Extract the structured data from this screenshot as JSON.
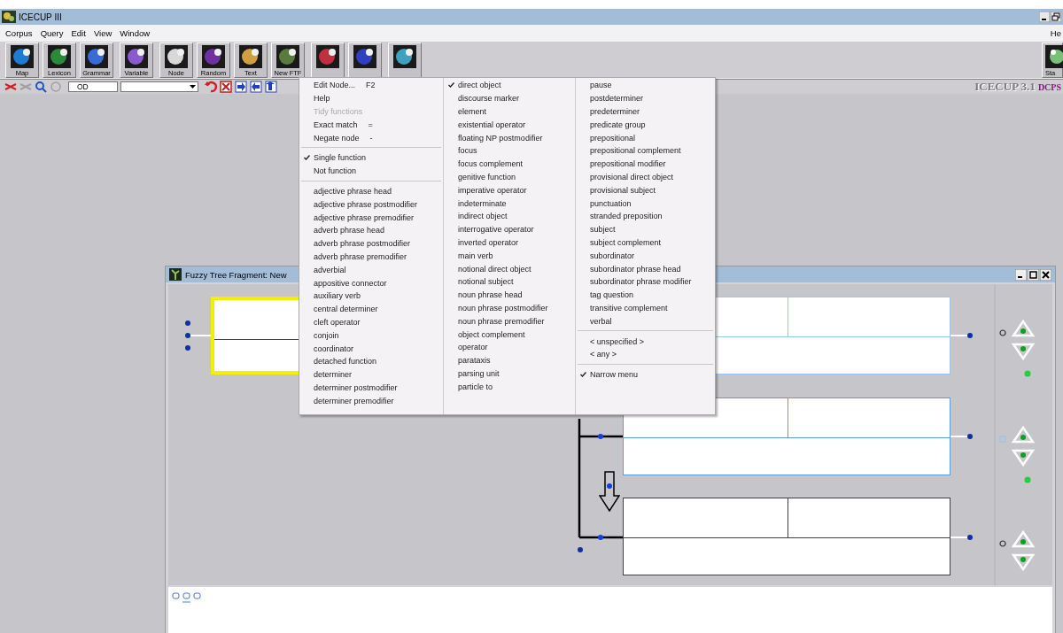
{
  "window": {
    "title": "ICECUP III"
  },
  "menu_bar": {
    "items": [
      "Corpus",
      "Query",
      "Edit",
      "View",
      "Window"
    ],
    "right_item": "He"
  },
  "toolbar": {
    "buttons": [
      {
        "kind": "labeled",
        "label": "Map"
      },
      {
        "kind": "labeled",
        "label": "Lexicon"
      },
      {
        "kind": "labeled",
        "label": "Grammar"
      },
      {
        "kind": "labeled",
        "label": "Variable"
      },
      {
        "kind": "labeled",
        "label": "Node"
      },
      {
        "kind": "labeled",
        "label": "Random"
      },
      {
        "kind": "labeled",
        "label": "Text"
      },
      {
        "kind": "labeled",
        "label": "New FTF"
      },
      {
        "kind": "covered"
      },
      {
        "kind": "covered"
      },
      {
        "kind": "covered"
      }
    ],
    "right_button": {
      "label": "Sta"
    }
  },
  "query_bar": {
    "node_field": "OD",
    "brand": "ICECUP 3.1",
    "brand_suffix": "DCPS"
  },
  "context_menu": {
    "columns": [
      [
        {
          "kind": "item",
          "label": "Edit Node...",
          "shortcut": "F2",
          "checked": false,
          "disabled": false
        },
        {
          "kind": "item",
          "label": "Help",
          "checked": false,
          "disabled": false
        },
        {
          "kind": "item",
          "label": "Tidy functions",
          "checked": false,
          "disabled": true
        },
        {
          "kind": "item",
          "label": "Exact match",
          "shortcut": "=",
          "checked": false,
          "disabled": false
        },
        {
          "kind": "item",
          "label": "Negate node",
          "shortcut": "-",
          "checked": false,
          "disabled": false
        },
        {
          "kind": "separator"
        },
        {
          "kind": "item",
          "label": "Single function",
          "checked": true,
          "disabled": false
        },
        {
          "kind": "item",
          "label": "Not function",
          "checked": false,
          "disabled": false
        },
        {
          "kind": "separator"
        },
        {
          "kind": "item",
          "label": "adjective phrase head",
          "checked": false,
          "disabled": false
        },
        {
          "kind": "item",
          "label": "adjective phrase postmodifier",
          "checked": false,
          "disabled": false
        },
        {
          "kind": "item",
          "label": "adjective phrase premodifier",
          "checked": false,
          "disabled": false
        },
        {
          "kind": "item",
          "label": "adverb phrase head",
          "checked": false,
          "disabled": false
        },
        {
          "kind": "item",
          "label": "adverb phrase postmodifier",
          "checked": false,
          "disabled": false
        },
        {
          "kind": "item",
          "label": "adverb phrase premodifier",
          "checked": false,
          "disabled": false
        },
        {
          "kind": "item",
          "label": "adverbial",
          "checked": false,
          "disabled": false
        },
        {
          "kind": "item",
          "label": "appositive connector",
          "checked": false,
          "disabled": false
        },
        {
          "kind": "item",
          "label": "auxiliary verb",
          "checked": false,
          "disabled": false
        },
        {
          "kind": "item",
          "label": "central determiner",
          "checked": false,
          "disabled": false
        },
        {
          "kind": "item",
          "label": "cleft operator",
          "checked": false,
          "disabled": false
        },
        {
          "kind": "item",
          "label": "conjoin",
          "checked": false,
          "disabled": false
        },
        {
          "kind": "item",
          "label": "coordinator",
          "checked": false,
          "disabled": false
        },
        {
          "kind": "item",
          "label": "detached function",
          "checked": false,
          "disabled": false
        },
        {
          "kind": "item",
          "label": "determiner",
          "checked": false,
          "disabled": false
        },
        {
          "kind": "item",
          "label": "determiner postmodifier",
          "checked": false,
          "disabled": false
        },
        {
          "kind": "item",
          "label": "determiner premodifier",
          "checked": false,
          "disabled": false
        }
      ],
      [
        {
          "kind": "item",
          "label": "direct object",
          "checked": true,
          "disabled": false
        },
        {
          "kind": "item",
          "label": "discourse marker",
          "checked": false,
          "disabled": false
        },
        {
          "kind": "item",
          "label": "element",
          "checked": false,
          "disabled": false
        },
        {
          "kind": "item",
          "label": "existential operator",
          "checked": false,
          "disabled": false
        },
        {
          "kind": "item",
          "label": "floating NP postmodifier",
          "checked": false,
          "disabled": false
        },
        {
          "kind": "item",
          "label": "focus",
          "checked": false,
          "disabled": false
        },
        {
          "kind": "item",
          "label": "focus complement",
          "checked": false,
          "disabled": false
        },
        {
          "kind": "item",
          "label": "genitive function",
          "checked": false,
          "disabled": false
        },
        {
          "kind": "item",
          "label": "imperative operator",
          "checked": false,
          "disabled": false
        },
        {
          "kind": "item",
          "label": "indeterminate",
          "checked": false,
          "disabled": false
        },
        {
          "kind": "item",
          "label": "indirect object",
          "checked": false,
          "disabled": false
        },
        {
          "kind": "item",
          "label": "interrogative operator",
          "checked": false,
          "disabled": false
        },
        {
          "kind": "item",
          "label": "inverted operator",
          "checked": false,
          "disabled": false
        },
        {
          "kind": "item",
          "label": "main verb",
          "checked": false,
          "disabled": false
        },
        {
          "kind": "item",
          "label": "notional direct object",
          "checked": false,
          "disabled": false
        },
        {
          "kind": "item",
          "label": "notional subject",
          "checked": false,
          "disabled": false
        },
        {
          "kind": "item",
          "label": "noun phrase head",
          "checked": false,
          "disabled": false
        },
        {
          "kind": "item",
          "label": "noun phrase postmodifier",
          "checked": false,
          "disabled": false
        },
        {
          "kind": "item",
          "label": "noun phrase premodifier",
          "checked": false,
          "disabled": false
        },
        {
          "kind": "item",
          "label": "object complement",
          "checked": false,
          "disabled": false
        },
        {
          "kind": "item",
          "label": "operator",
          "checked": false,
          "disabled": false
        },
        {
          "kind": "item",
          "label": "parataxis",
          "checked": false,
          "disabled": false
        },
        {
          "kind": "item",
          "label": "parsing unit",
          "checked": false,
          "disabled": false
        },
        {
          "kind": "item",
          "label": "particle to",
          "checked": false,
          "disabled": false
        }
      ],
      [
        {
          "kind": "item",
          "label": "pause",
          "checked": false,
          "disabled": false
        },
        {
          "kind": "item",
          "label": "postdeterminer",
          "checked": false,
          "disabled": false
        },
        {
          "kind": "item",
          "label": "predeterminer",
          "checked": false,
          "disabled": false
        },
        {
          "kind": "item",
          "label": "predicate group",
          "checked": false,
          "disabled": false
        },
        {
          "kind": "item",
          "label": "prepositional",
          "checked": false,
          "disabled": false
        },
        {
          "kind": "item",
          "label": "prepositional complement",
          "checked": false,
          "disabled": false
        },
        {
          "kind": "item",
          "label": "prepositional modifier",
          "checked": false,
          "disabled": false
        },
        {
          "kind": "item",
          "label": "provisional direct object",
          "checked": false,
          "disabled": false
        },
        {
          "kind": "item",
          "label": "provisional subject",
          "checked": false,
          "disabled": false
        },
        {
          "kind": "item",
          "label": "punctuation",
          "checked": false,
          "disabled": false
        },
        {
          "kind": "item",
          "label": "stranded preposition",
          "checked": false,
          "disabled": false
        },
        {
          "kind": "item",
          "label": "subject",
          "checked": false,
          "disabled": false
        },
        {
          "kind": "item",
          "label": "subject complement",
          "checked": false,
          "disabled": false
        },
        {
          "kind": "item",
          "label": "subordinator",
          "checked": false,
          "disabled": false
        },
        {
          "kind": "item",
          "label": "subordinator phrase head",
          "checked": false,
          "disabled": false
        },
        {
          "kind": "item",
          "label": "subordinator phrase modifier",
          "checked": false,
          "disabled": false
        },
        {
          "kind": "item",
          "label": "tag question",
          "checked": false,
          "disabled": false
        },
        {
          "kind": "item",
          "label": "transitive complement",
          "checked": false,
          "disabled": false
        },
        {
          "kind": "item",
          "label": "verbal",
          "checked": false,
          "disabled": false
        },
        {
          "kind": "separator"
        },
        {
          "kind": "item",
          "label": "< unspecified >",
          "checked": false,
          "disabled": false
        },
        {
          "kind": "item",
          "label": "< any >",
          "checked": false,
          "disabled": false
        },
        {
          "kind": "separator"
        },
        {
          "kind": "item",
          "label": "Narrow menu",
          "checked": true,
          "disabled": false
        }
      ]
    ]
  },
  "ftf_window": {
    "title": "Fuzzy Tree Fragment: New",
    "nodes": [
      {
        "color": "#f0f000"
      },
      {
        "color": "#9cc3ec"
      },
      {
        "color": "#5b9be0"
      },
      {
        "color": "#404040"
      }
    ],
    "side_rows": [
      {
        "kind": "circle"
      },
      {
        "kind": "square"
      },
      {
        "kind": "circle"
      }
    ]
  }
}
